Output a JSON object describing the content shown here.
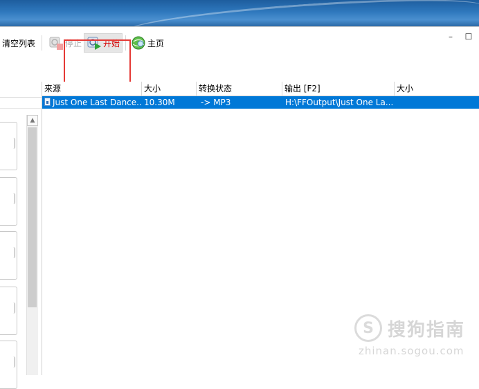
{
  "window": {
    "minimize_symbol": "–",
    "maximize_symbol": "☐"
  },
  "toolbar": {
    "clear_list": "清空列表",
    "stop": "停止",
    "start": "开始",
    "home": "主页"
  },
  "list": {
    "columns": [
      "来源",
      "大小",
      "转换状态",
      "输出 [F2]",
      "大小"
    ],
    "rows": [
      {
        "source": "Just One Last Dance...",
        "size": "10.30M",
        "status": "-> MP3",
        "output": "H:\\FFOutput\\Just One La...",
        "out_size": ""
      }
    ]
  },
  "watermark": {
    "title": "搜狗指南",
    "url": "zhinan.sogou.com"
  },
  "colors": {
    "selection": "#0078d7",
    "highlight_box": "#e53935",
    "start_label": "#d40000"
  }
}
